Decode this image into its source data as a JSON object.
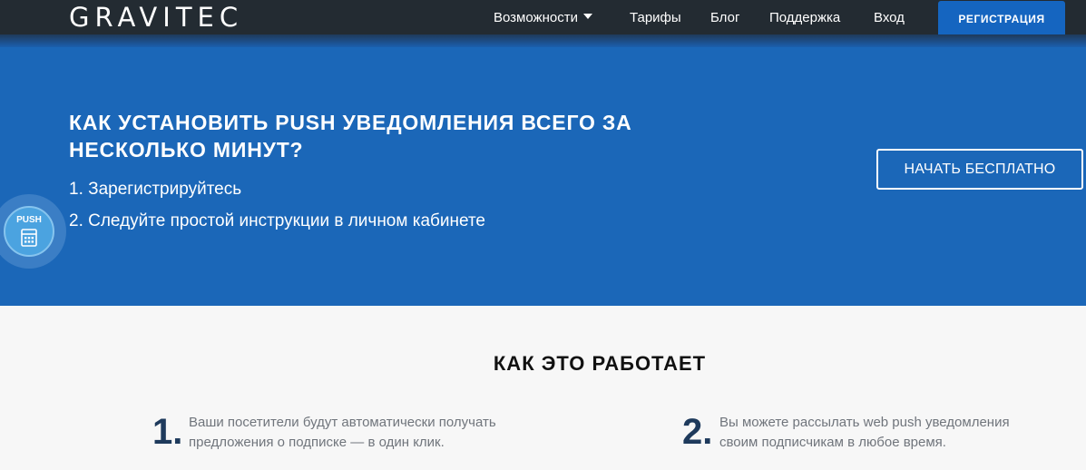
{
  "header": {
    "logo": "GRAVITEC",
    "nav": [
      {
        "label": "Возможности",
        "has_dropdown": true
      },
      {
        "label": "Тарифы"
      },
      {
        "label": "Блог"
      },
      {
        "label": "Поддержка"
      },
      {
        "label": "Вход"
      }
    ],
    "register_label": "РЕГИСТРАЦИЯ"
  },
  "hero": {
    "title": "КАК УСТАНОВИТЬ PUSH УВЕДОМЛЕНИЯ ВСЕГО ЗА НЕСКОЛЬКО МИНУТ?",
    "steps": [
      "1. Зарегистрируйтесь",
      "2. Следуйте простой инструкции в личном кабинете"
    ],
    "cta_label": "НАЧАТЬ БЕСПЛАТНО"
  },
  "push_widget": {
    "label": "PUSH",
    "icon": "calendar-icon"
  },
  "how_it_works": {
    "title": "КАК ЭТО РАБОТАЕТ",
    "steps": [
      {
        "number": "1.",
        "text": "Ваши посетители будут автоматически получать предложения о подписке — в один клик."
      },
      {
        "number": "2.",
        "text": "Вы можете рассылать web push уведомления своим подписчикам в любое время."
      }
    ]
  },
  "colors": {
    "header_bg": "#232b32",
    "hero_bg": "#1b67b8",
    "accent": "#1565c0",
    "step_number": "#1e3a5c"
  }
}
